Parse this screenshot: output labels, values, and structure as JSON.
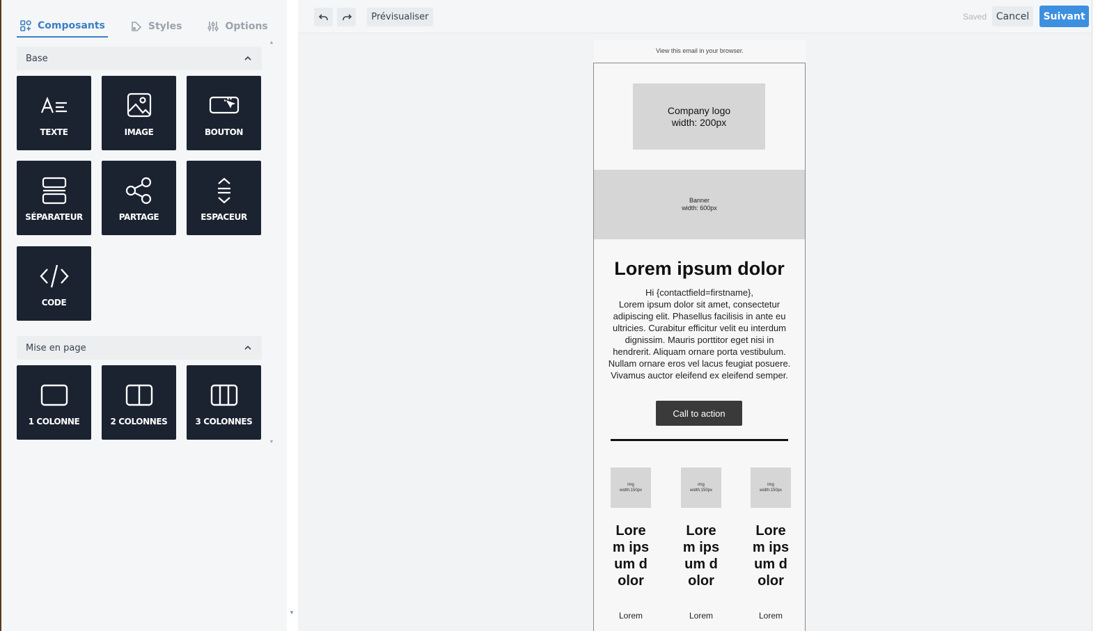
{
  "tabs": [
    {
      "label": "Composants",
      "icon": "components-icon",
      "active": true
    },
    {
      "label": "Styles",
      "icon": "styles-icon",
      "active": false
    },
    {
      "label": "Options",
      "icon": "sliders-icon",
      "active": false
    }
  ],
  "sections": {
    "base": {
      "title": "Base",
      "tiles": [
        {
          "label": "TEXTE",
          "icon": "text-icon"
        },
        {
          "label": "IMAGE",
          "icon": "image-icon"
        },
        {
          "label": "BOUTON",
          "icon": "button-icon"
        },
        {
          "label": "SÉPARATEUR",
          "icon": "separator-icon"
        },
        {
          "label": "PARTAGE",
          "icon": "share-icon"
        },
        {
          "label": "ESPACEUR",
          "icon": "spacer-icon"
        },
        {
          "label": "CODE",
          "icon": "code-icon"
        }
      ]
    },
    "layout": {
      "title": "Mise en page",
      "tiles": [
        {
          "label": "1 COLONNE",
          "icon": "one-column-icon"
        },
        {
          "label": "2 COLONNES",
          "icon": "two-columns-icon"
        },
        {
          "label": "3 COLONNES",
          "icon": "three-columns-icon"
        }
      ]
    }
  },
  "toolbar": {
    "undo_icon": "undo-icon",
    "redo_icon": "redo-icon",
    "preview_label": "Prévisualiser",
    "saved_label": "Saved",
    "cancel_label": "Cancel",
    "next_label": "Suivant"
  },
  "email": {
    "preheader": "View this email in your browser.",
    "logo_line1": "Company logo",
    "logo_line2": "width: 200px",
    "banner_line1": "Banner",
    "banner_line2": "width: 600px",
    "heading": "Lorem ipsum dolor",
    "greeting": "Hi {contactfield=firstname},",
    "body": "Lorem ipsum dolor sit amet, consectetur adipiscing elit. Phasellus facilisis in ante eu ultricies. Curabitur efficitur velit eu interdum dignissim. Mauris porttitor eget nisi in hendrerit. Aliquam ornare porta vestibulum. Nullam ornare eros vel lacus feugiat posuere. Vivamus auctor eleifend ex eleifend semper.",
    "cta": "Call to action",
    "columns": [
      {
        "img_line1": "img",
        "img_line2": "width:150px",
        "title": "Lorem ipsum dolor",
        "sub": "Lorem"
      },
      {
        "img_line1": "img",
        "img_line2": "width:150px",
        "title": "Lorem ipsum dolor",
        "sub": "Lorem"
      },
      {
        "img_line1": "img",
        "img_line2": "width:150px",
        "title": "Lorem ipsum dolor",
        "sub": "Lorem"
      }
    ]
  },
  "colors": {
    "accent": "#3b7fc4",
    "primary_button": "#3d8fdf",
    "tile_bg": "#1b2230",
    "cta_bg": "#3a3a3a"
  }
}
